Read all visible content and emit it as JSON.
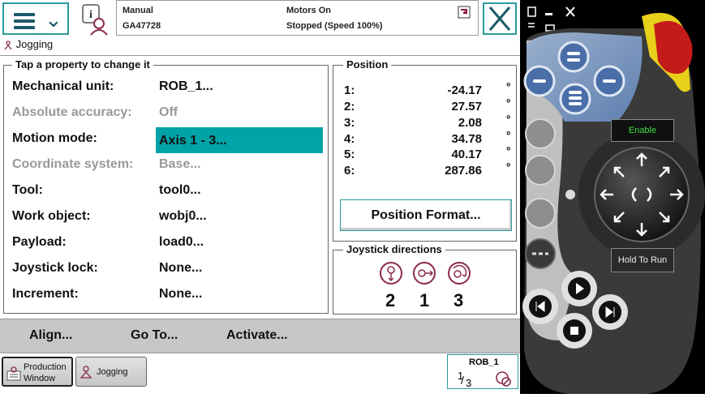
{
  "header": {
    "mode": "Manual",
    "system_name": "GA47728",
    "motor_state": "Motors On",
    "run_state": "Stopped (Speed 100%)"
  },
  "app_title": "Jogging",
  "properties": {
    "legend": "Tap a property to change it",
    "rows": [
      {
        "label": "Mechanical unit:",
        "value": "ROB_1...",
        "enabled": true
      },
      {
        "label": "Absolute accuracy:",
        "value": "Off",
        "enabled": false
      },
      {
        "label": "Motion mode:",
        "value": "Axis 1 - 3...",
        "enabled": true,
        "selected": true
      },
      {
        "label": "Coordinate system:",
        "value": "Base...",
        "enabled": false
      },
      {
        "label": "Tool:",
        "value": "tool0...",
        "enabled": true
      },
      {
        "label": "Work object:",
        "value": "wobj0...",
        "enabled": true
      },
      {
        "label": "Payload:",
        "value": "load0...",
        "enabled": true
      },
      {
        "label": "Joystick lock:",
        "value": "None...",
        "enabled": true
      },
      {
        "label": "Increment:",
        "value": "None...",
        "enabled": true
      }
    ]
  },
  "position": {
    "legend": "Position",
    "unit": "º",
    "rows": [
      {
        "axis": "1:",
        "value": "-24.17"
      },
      {
        "axis": "2:",
        "value": "27.57"
      },
      {
        "axis": "3:",
        "value": "2.08"
      },
      {
        "axis": "4:",
        "value": "34.78"
      },
      {
        "axis": "5:",
        "value": "40.17"
      },
      {
        "axis": "6:",
        "value": "287.86"
      }
    ],
    "format_button": "Position Format..."
  },
  "joystick": {
    "legend": "Joystick directions",
    "axes": [
      "2",
      "1",
      "3"
    ]
  },
  "actions": {
    "align": "Align...",
    "goto": "Go To...",
    "activate": "Activate..."
  },
  "taskbar": {
    "production_line1": "Production",
    "production_line2": "Window",
    "jogging": "Jogging",
    "rob_label": "ROB_1",
    "rob_fraction_num": "1",
    "rob_fraction_den": "3"
  },
  "flexpendant": {
    "enable_label": "Enable",
    "hold_label": "Hold To Run"
  },
  "colors": {
    "accent": "#00a3a6",
    "frame": "#2a9a9a",
    "enable_text": "#3ddc3d",
    "emergency": "#cc1a1a"
  }
}
